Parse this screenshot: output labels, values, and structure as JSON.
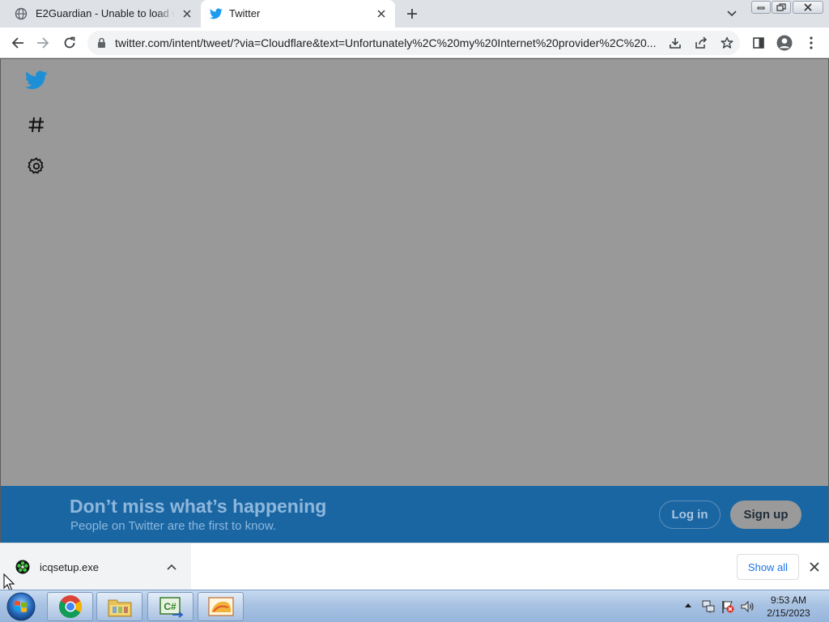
{
  "browser": {
    "tabs": [
      {
        "title": "E2Guardian - Unable to load web",
        "favicon": "globe-icon",
        "active": false
      },
      {
        "title": "Twitter",
        "favicon": "twitter-bird-icon",
        "active": true
      }
    ],
    "url": "twitter.com/intent/tweet/?via=Cloudflare&text=Unfortunately%2C%20my%20Internet%20provider%2C%20..."
  },
  "page": {
    "sidebar_icons": [
      "twitter-bird-icon",
      "hashtag-icon",
      "settings-gear-icon"
    ],
    "banner": {
      "title": "Don’t miss what’s happening",
      "subtitle": "People on Twitter are the first to know.",
      "login_label": "Log in",
      "signup_label": "Sign up"
    }
  },
  "downloads": {
    "file_name": "icqsetup.exe",
    "show_all_label": "Show all"
  },
  "taskbar": {
    "time": "9:53 AM",
    "date": "2/15/2023"
  },
  "colors": {
    "overlay": "#999999",
    "banner": "#1a66a3",
    "twitter_blue": "#1d9bf0",
    "link_blue": "#1a73e8"
  }
}
